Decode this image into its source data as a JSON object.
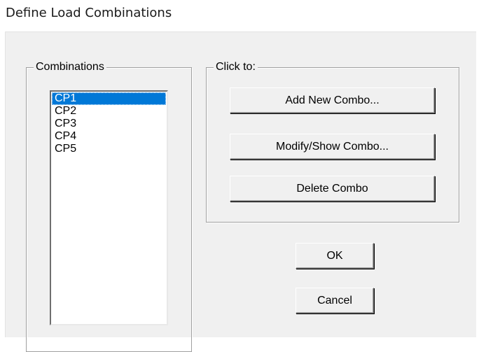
{
  "window": {
    "title": "Define Load Combinations"
  },
  "combinations": {
    "legend": "Combinations",
    "items": [
      "CP1",
      "CP2",
      "CP3",
      "CP4",
      "CP5"
    ],
    "selected": "CP1"
  },
  "click_to": {
    "legend": "Click to:",
    "add_label": "Add New Combo...",
    "modify_label": "Modify/Show Combo...",
    "delete_label": "Delete Combo"
  },
  "actions": {
    "ok_label": "OK",
    "cancel_label": "Cancel"
  },
  "colors": {
    "selection": "#0078d7",
    "dialog_background": "#f0f0f0"
  }
}
